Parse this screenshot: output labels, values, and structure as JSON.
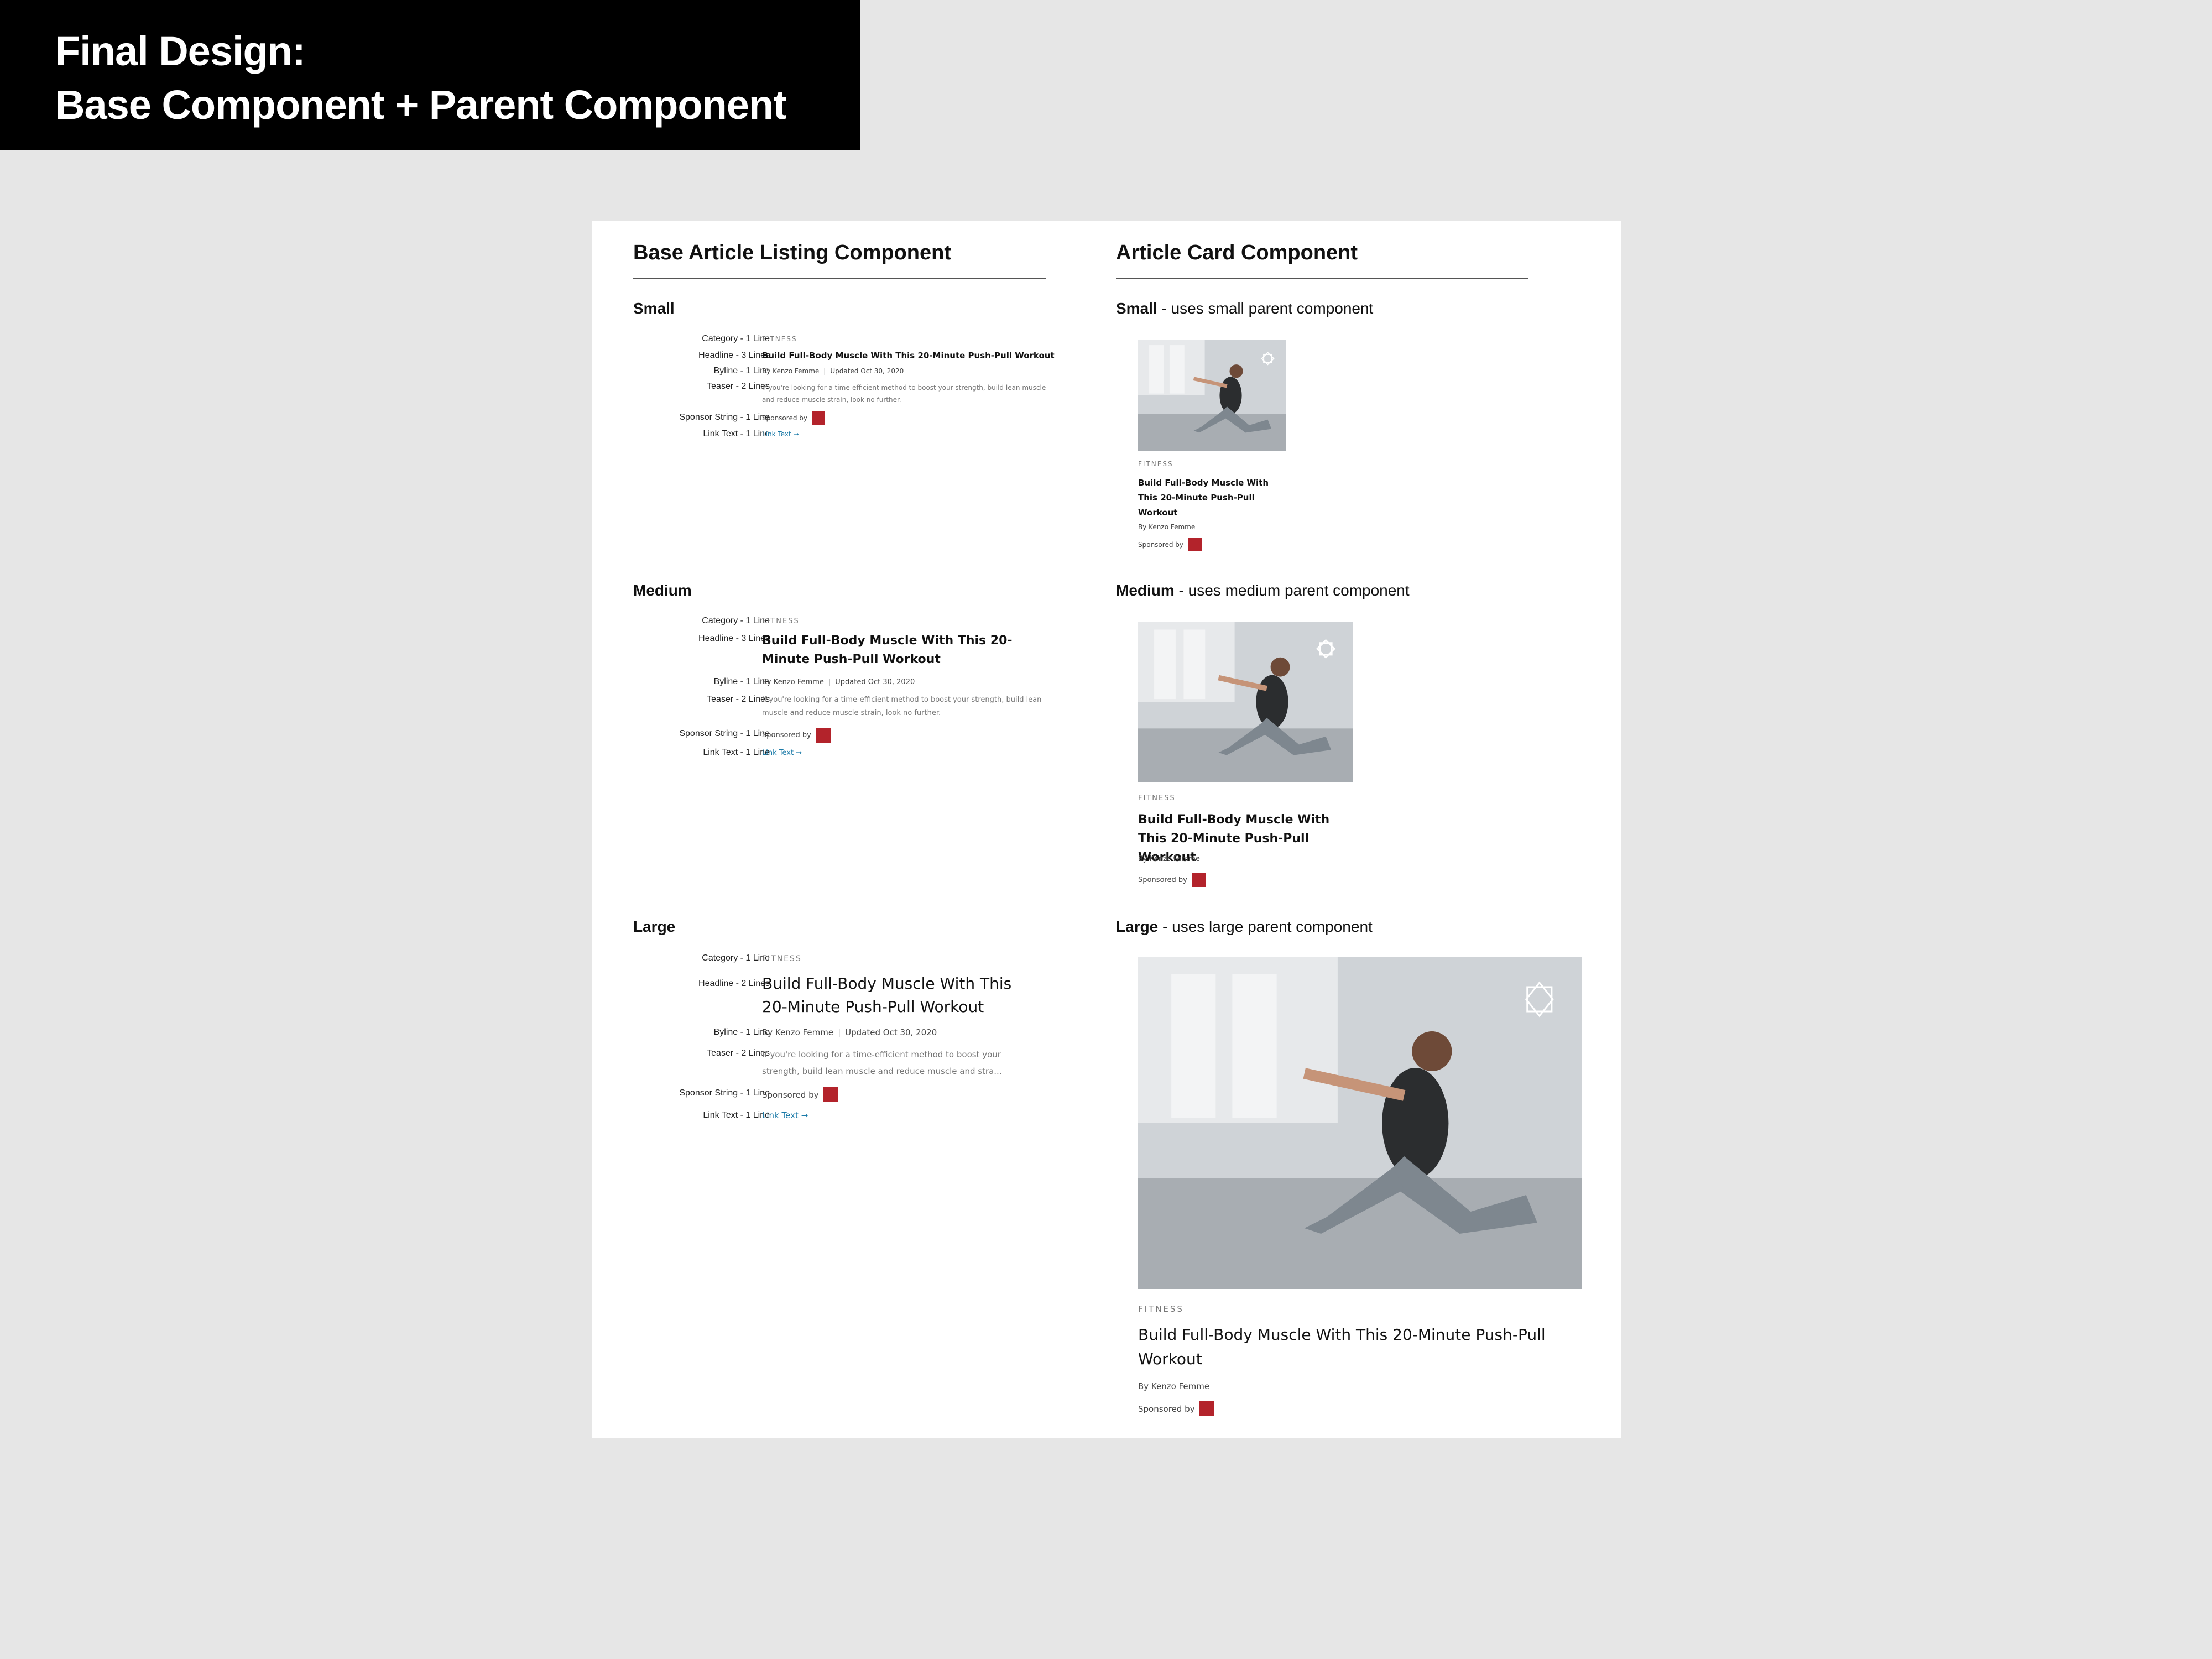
{
  "banner": {
    "line1": "Final Design:",
    "line2": "Base Component + Parent Component"
  },
  "base": {
    "title": "Base Article Listing Component",
    "sections": {
      "small": {
        "label": "Small"
      },
      "medium": {
        "label": "Medium"
      },
      "large": {
        "label": "Large"
      }
    },
    "labels": {
      "category": "Category - 1 Line",
      "headline3": "Headline - 3 Lines",
      "headline2": "Headline - 2 Lines",
      "byline": "Byline - 1 Line",
      "teaser": "Teaser - 2 Lines",
      "sponsor": "Sponsor String - 1 Line",
      "link": "Link Text - 1 Line"
    }
  },
  "article": {
    "category": "FITNESS",
    "headline": "Build Full-Body Muscle With This 20-Minute Push-Pull Workout",
    "byline_prefix": "By",
    "author": "Kenzo Femme",
    "updated": "Updated Oct 30, 2020",
    "teaser": "If you're looking for a time-efficient method to boost your strength, build lean muscle and reduce muscle strain, look no further.",
    "teaser_truncated": "If you're looking for a time-efficient method to boost your strength, build lean muscle and reduce muscle and stra...",
    "sponsored_by": "Sponsored by",
    "link_text": "Link Text →",
    "sponsor_color": "#b3232b",
    "link_color": "#1a7aa8"
  },
  "card": {
    "title": "Article Card Component",
    "small": {
      "bold": "Small",
      "rest": " - uses small parent component"
    },
    "medium": {
      "bold": "Medium",
      "rest": " - uses medium parent component"
    },
    "large": {
      "bold": "Large",
      "rest": " - uses large parent component"
    },
    "byline": "By Kenzo Femme"
  }
}
